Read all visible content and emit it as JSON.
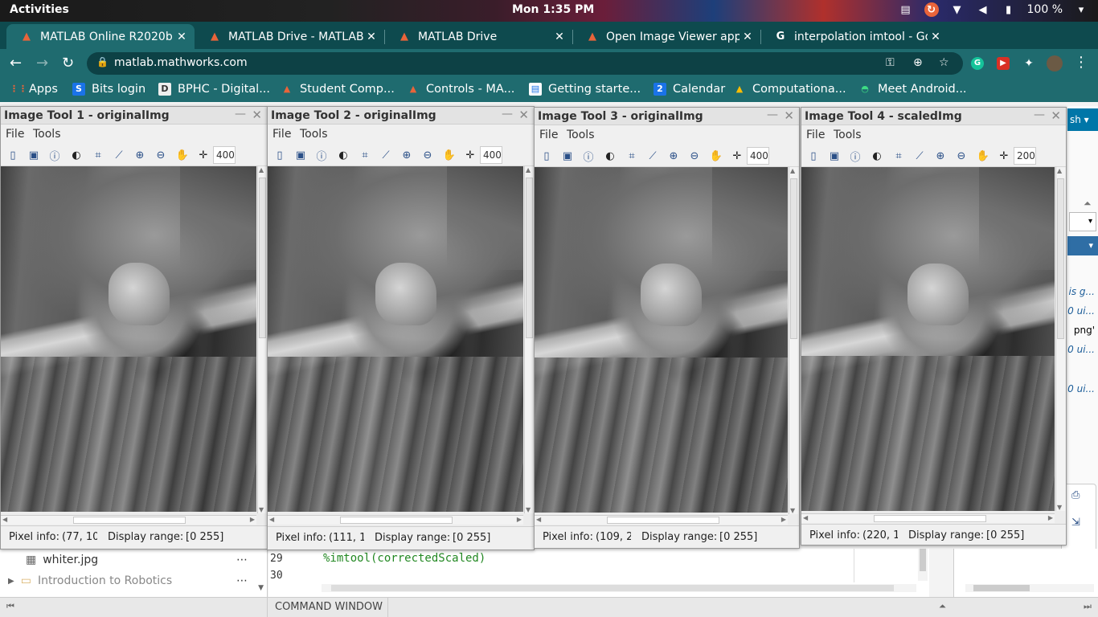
{
  "topbar": {
    "activities": "Activities",
    "clock": "Mon  1:35 PM",
    "battery": "100 %"
  },
  "tabs": [
    {
      "title": "MATLAB Online R2020b",
      "icon": "matlab-icon"
    },
    {
      "title": "MATLAB Drive - MATLAB",
      "icon": "matlab-icon"
    },
    {
      "title": "MATLAB Drive",
      "icon": "matlab-icon"
    },
    {
      "title": "Open Image Viewer app -",
      "icon": "matlab-icon"
    },
    {
      "title": "interpolation imtool - Go",
      "icon": "google-icon"
    }
  ],
  "address": {
    "url": "matlab.mathworks.com"
  },
  "bookmarks": [
    {
      "label": "Apps",
      "icon": "apps-grid-icon",
      "color": "#4285f4"
    },
    {
      "label": "Bits login",
      "icon": "bits-icon",
      "color": "#1a73e8"
    },
    {
      "label": "BPHC - Digital...",
      "icon": "d-icon",
      "color": "#444444"
    },
    {
      "label": "Student Comp...",
      "icon": "matlab-icon",
      "color": "#e8643a"
    },
    {
      "label": "Controls - MA...",
      "icon": "matlab-icon",
      "color": "#e8643a"
    },
    {
      "label": "Getting starte...",
      "icon": "doc-icon",
      "color": "#1a73e8"
    },
    {
      "label": "Calendar",
      "icon": "calendar-icon",
      "color": "#1a73e8"
    },
    {
      "label": "Computationa...",
      "icon": "drive-icon",
      "color": "#fbbc04"
    },
    {
      "label": "Meet Android...",
      "icon": "android-icon",
      "color": "#3ddc84"
    }
  ],
  "imtools": [
    {
      "title": "Image Tool 1 - originalImg",
      "zoom": "400",
      "pixel_label": "Pixel info:",
      "pixel_value": "(77, 10(",
      "range_label": "Display range:",
      "range_value": "[0 255]"
    },
    {
      "title": "Image Tool 2 - originalImg",
      "zoom": "400",
      "pixel_label": "Pixel info:",
      "pixel_value": "(111, 1(",
      "range_label": "Display range:",
      "range_value": "[0 255]"
    },
    {
      "title": "Image Tool 3 - originalImg",
      "zoom": "400",
      "pixel_label": "Pixel info:",
      "pixel_value": "(109, 2",
      "range_label": "Display range:",
      "range_value": "[0 255]"
    },
    {
      "title": "Image Tool 4 - scaledImg",
      "zoom": "200",
      "pixel_label": "Pixel info:",
      "pixel_value": "(220, 1",
      "range_label": "Display range:",
      "range_value": "[0 255]"
    }
  ],
  "menu": {
    "file": "File",
    "tools": "Tools"
  },
  "file_browser": {
    "rows": [
      {
        "label": "whiter.jpg",
        "icon": "image-file-icon"
      },
      {
        "label": "Introduction to Robotics",
        "icon": "folder-icon"
      }
    ]
  },
  "editor": {
    "lines": [
      {
        "num": "29",
        "code": "%imtool(correctedScaled)"
      },
      {
        "num": "30",
        "code": ""
      }
    ]
  },
  "command_window": "COMMAND WINDOW",
  "right_panel": {
    "button": "sh",
    "workspace_snippets": [
      "is g...",
      "0 ui...",
      "png'",
      "0 ui...",
      "0 ui..."
    ]
  }
}
